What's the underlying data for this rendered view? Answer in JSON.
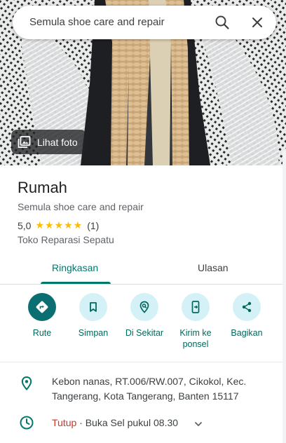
{
  "search": {
    "query": "Semula shoe care and repair",
    "search_icon": "search-icon",
    "close_icon": "close-icon"
  },
  "hero": {
    "photo_button_label": "Lihat foto",
    "photo_icon": "photo-library-icon"
  },
  "place": {
    "title": "Rumah",
    "subtitle": "Semula shoe care and repair",
    "rating_value": "5,0",
    "stars": "★★★★★",
    "review_count": "(1)",
    "category": "Toko Reparasi Sepatu"
  },
  "tabs": {
    "overview": "Ringkasan",
    "reviews": "Ulasan"
  },
  "actions": [
    {
      "label": "Rute",
      "icon": "directions-icon"
    },
    {
      "label": "Simpan",
      "icon": "bookmark-icon"
    },
    {
      "label": "Di Sekitar",
      "icon": "nearby-icon"
    },
    {
      "label": "Kirim ke ponsel",
      "icon": "send-to-phone-icon"
    },
    {
      "label": "Bagikan",
      "icon": "share-icon"
    }
  ],
  "info": {
    "address": "Kebon nanas, RT.006/RW.007, Cikokol, Kec. Tangerang, Kota Tangerang, Banten 15117",
    "hours_status": "Tutup",
    "hours_detail": " · Buka Sel pukul 08.30"
  },
  "colors": {
    "accent": "#00796b",
    "action_bg": "#d3f1f7",
    "primary_action_bg": "#0b6e70",
    "closed": "#d93025",
    "star": "#fbbc04"
  }
}
